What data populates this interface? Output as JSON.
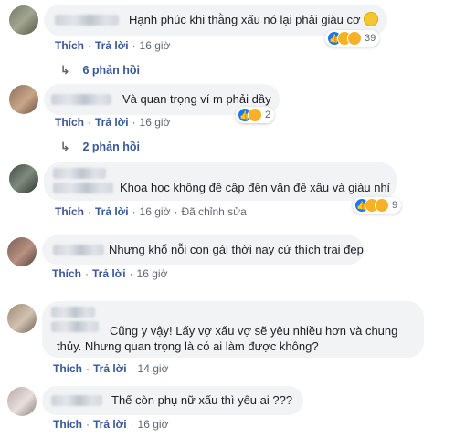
{
  "comments": [
    {
      "text": "Hạnh phúc khi thằng xấu nó lại phải giàu cơ",
      "has_emoji": true,
      "reactions": [
        "like",
        "haha",
        "wow"
      ],
      "reaction_count": "39",
      "like_label": "Thích",
      "reply_label": "Trả lời",
      "time": "16 giờ",
      "edited": "",
      "replies_label": "6 phản hồi"
    },
    {
      "text": "Và quan trọng ví m phải dầy",
      "reactions": [
        "like",
        "haha"
      ],
      "reaction_count": "2",
      "like_label": "Thích",
      "reply_label": "Trả lời",
      "time": "16 giờ",
      "edited": "",
      "replies_label": "2 phản hồi"
    },
    {
      "text": "Khoa học không đề cập đến vấn đề xấu và giàu nhỉ",
      "reactions": [
        "like",
        "haha",
        "wow"
      ],
      "reaction_count": "9",
      "like_label": "Thích",
      "reply_label": "Trả lời",
      "time": "16 giờ",
      "edited": "Đã chỉnh sửa"
    },
    {
      "text": "Nhưng khổ nỗi con gái thời nay cứ thích trai đẹp",
      "like_label": "Thích",
      "reply_label": "Trả lời",
      "time": "16 giờ"
    },
    {
      "text_line1": "Cũng y vậy! Lấy vợ xấu vợ sẽ yêu nhiều hơn và chung",
      "text_line2": "thủy. Nhưng quan trọng là có ai làm được không?",
      "like_label": "Thích",
      "reply_label": "Trả lời",
      "time": "14 giờ"
    },
    {
      "text": "Thế còn phụ nữ xấu thì yêu ai ???",
      "like_label": "Thích",
      "reply_label": "Trả lời",
      "time": "16 giờ"
    }
  ],
  "separator": "·",
  "colors": {
    "link": "#385898",
    "bubble": "#f2f3f5",
    "meta": "#606770",
    "like": "#1877f2",
    "haha": "#f7b125"
  }
}
